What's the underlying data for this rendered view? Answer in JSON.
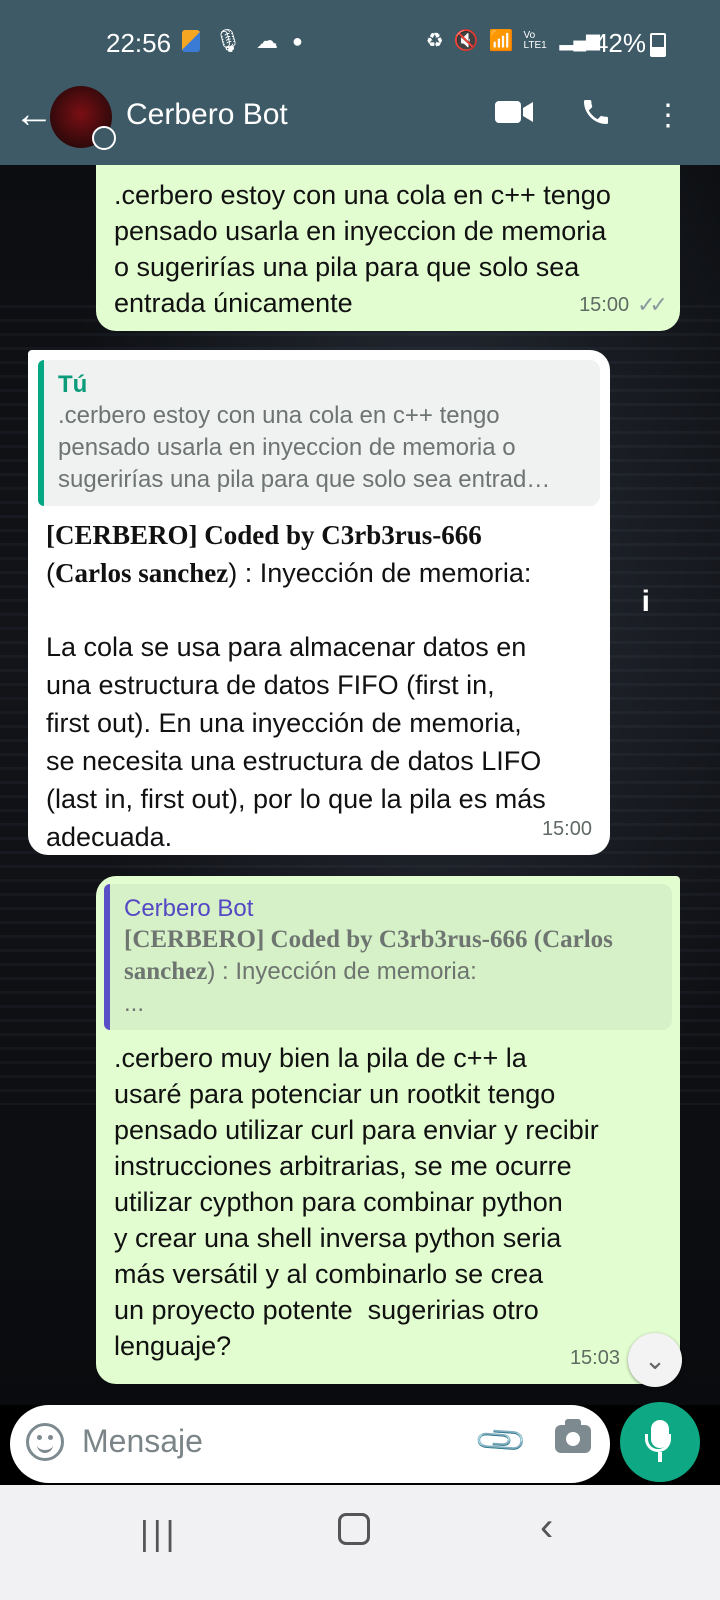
{
  "status_bar": {
    "time": "22:56",
    "battery": "42%",
    "icons": [
      "app-notification-icon",
      "mic-icon",
      "cloud-icon",
      "dot-icon",
      "recycle-icon",
      "mute-icon",
      "wifi-icon",
      "volte-icon",
      "signal-icon",
      "battery-icon"
    ],
    "network_label": "Vo LTE1"
  },
  "app_bar": {
    "title": "Cerbero Bot",
    "icons": [
      "back-arrow-icon",
      "video-call-icon",
      "phone-icon",
      "more-vert-icon"
    ]
  },
  "messages": [
    {
      "direction": "out",
      "text": ".cerbero estoy con una cola en c++ tengo\npensado usarla en inyeccion de memoria\no sugerirías una pila para que solo sea\nentrada únicamente",
      "time": "15:00",
      "status": "read"
    },
    {
      "direction": "in",
      "quote": {
        "author": "Tú",
        "text": ".cerbero estoy con una cola en c++ tengo\npensado usarla en inyeccion de memoria o\nsugerirías una pila para que solo sea entrad…"
      },
      "header_bold": "[CERBERO] Coded by C3rb3rus-666",
      "header_paren_open": "(",
      "header_name": "Carlos sanchez",
      "header_rest": ") : Inyección de memoria:",
      "text": "La cola se usa para almacenar datos en\nuna estructura de datos FIFO (first in,\nfirst out). En una inyección de memoria,\nse necesita una estructura de datos LIFO\n(last in, first out), por lo que la pila es más\nadecuada.",
      "time": "15:00"
    },
    {
      "direction": "out",
      "quote": {
        "author": "Cerbero Bot",
        "text_bold": "[CERBERO] Coded by C3rb3rus-666 (Carlos\nsanchez",
        "text_rest": ") : Inyección de memoria:",
        "ellipsis": "..."
      },
      "text": ".cerbero muy bien la pila de c++ la\nusaré para potenciar un rootkit tengo\npensado utilizar curl para enviar y recibir\ninstrucciones arbitrarias, se me ocurre\nutilizar cypthon para combinar python\ny crear una shell inversa python seria\nmás versátil y al combinarlo se crea\nun proyecto potente  sugeririas otro\nlenguaje?",
      "time": "15:03"
    }
  ],
  "input": {
    "placeholder": "Mensaje",
    "icons": [
      "emoji-icon",
      "attach-icon",
      "camera-icon",
      "mic-icon"
    ]
  },
  "nav_bar": {
    "icons": [
      "recent-apps-icon",
      "home-icon",
      "back-icon"
    ]
  },
  "colors": {
    "header": "#3d5a66",
    "outgoing_bubble": "#e2fdd0",
    "incoming_bubble": "#ffffff",
    "accent": "#0fa884"
  }
}
